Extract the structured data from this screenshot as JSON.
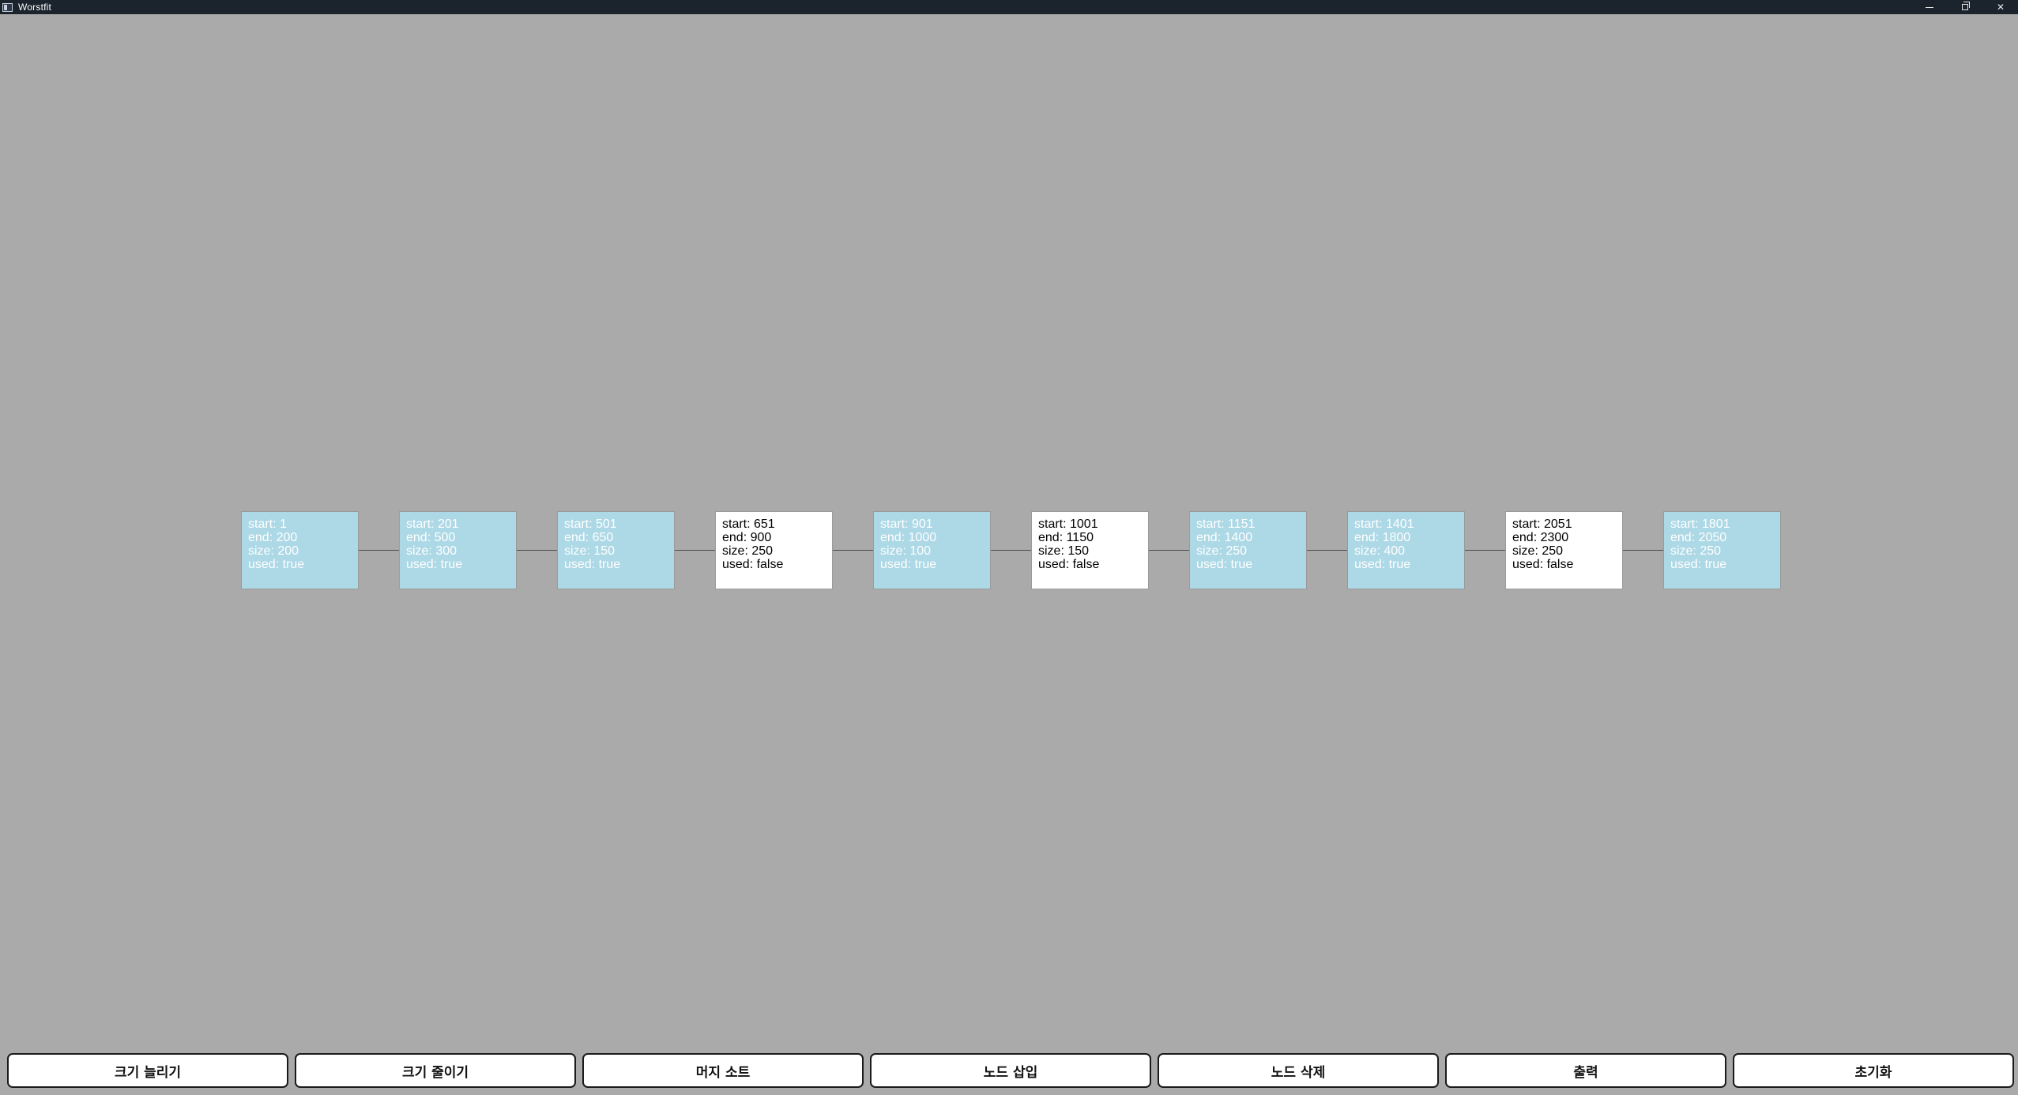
{
  "window": {
    "title": "Worstfit",
    "controls": [
      "minimize-icon",
      "restore-icon",
      "close-icon"
    ]
  },
  "colors": {
    "background": "#aaaaaa",
    "used_block": "#add8e6",
    "free_block": "#ffffff",
    "titlebar": "#1b232c"
  },
  "memory_blocks": [
    {
      "start": "start: 1",
      "end": "end: 200",
      "size": "size: 200",
      "used": "used: true",
      "is_used": true
    },
    {
      "start": "start: 201",
      "end": "end: 500",
      "size": "size: 300",
      "used": "used: true",
      "is_used": true
    },
    {
      "start": "start: 501",
      "end": "end: 650",
      "size": "size: 150",
      "used": "used: true",
      "is_used": true
    },
    {
      "start": "start: 651",
      "end": "end: 900",
      "size": "size: 250",
      "used": "used: false",
      "is_used": false
    },
    {
      "start": "start: 901",
      "end": "end: 1000",
      "size": "size: 100",
      "used": "used: true",
      "is_used": true
    },
    {
      "start": "start: 1001",
      "end": "end: 1150",
      "size": "size: 150",
      "used": "used: false",
      "is_used": false
    },
    {
      "start": "start: 1151",
      "end": "end: 1400",
      "size": "size: 250",
      "used": "used: true",
      "is_used": true
    },
    {
      "start": "start: 1401",
      "end": "end: 1800",
      "size": "size: 400",
      "used": "used: true",
      "is_used": true
    },
    {
      "start": "start: 2051",
      "end": "end: 2300",
      "size": "size: 250",
      "used": "used: false",
      "is_used": false
    },
    {
      "start": "start: 1801",
      "end": "end: 2050",
      "size": "size: 250",
      "used": "used: true",
      "is_used": true
    }
  ],
  "buttons": [
    {
      "name": "increase-size-button",
      "label": "크기 늘리기"
    },
    {
      "name": "decrease-size-button",
      "label": "크기 줄이기"
    },
    {
      "name": "merge-sort-button",
      "label": "머지 소트"
    },
    {
      "name": "insert-node-button",
      "label": "노드 삽입"
    },
    {
      "name": "delete-node-button",
      "label": "노드 삭제"
    },
    {
      "name": "print-button",
      "label": "출력"
    },
    {
      "name": "reset-button",
      "label": "초기화"
    }
  ]
}
